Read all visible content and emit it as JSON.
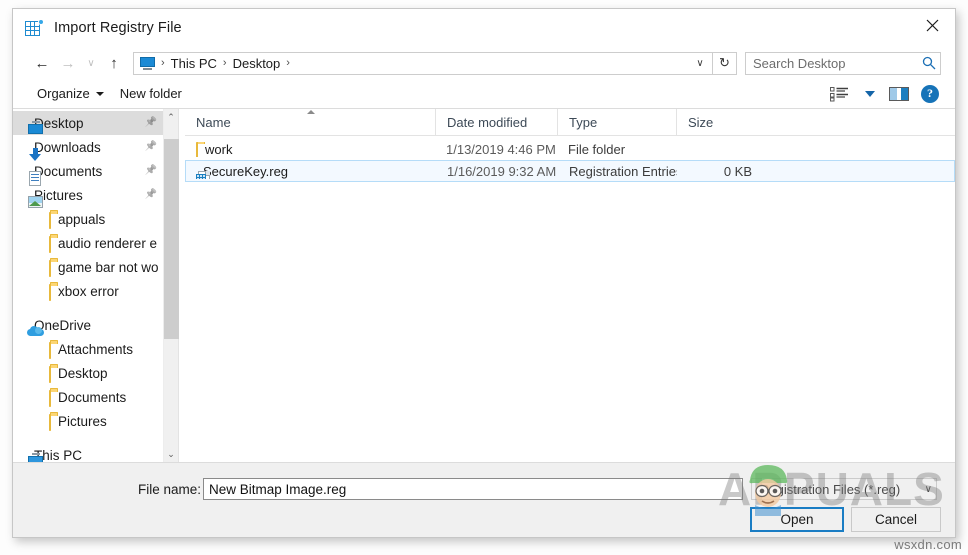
{
  "window": {
    "title": "Import Registry File",
    "icon": "registry-file-icon",
    "close_label": "✕"
  },
  "navigation": {
    "back_label": "←",
    "forward_label": "→",
    "recent_label": "∨",
    "up_label": "↑",
    "refresh_label": "↻",
    "dropdown_label": "∨",
    "breadcrumb": [
      {
        "label": "This PC"
      },
      {
        "label": "Desktop"
      }
    ],
    "breadcrumb_separator": "›"
  },
  "search": {
    "placeholder": "Search Desktop",
    "value": "Search Desktop",
    "icon": "search-icon"
  },
  "command_bar": {
    "organize_label": "Organize",
    "new_folder_label": "New folder",
    "view_icon": "view-options-icon",
    "view_caret": "▾",
    "preview_pane_icon": "preview-pane-icon",
    "help_label": "?"
  },
  "nav_pane": {
    "items": [
      {
        "label": "Desktop",
        "icon": "monitor-icon",
        "indent": 0,
        "pinned": true,
        "selected": true
      },
      {
        "label": "Downloads",
        "icon": "download-icon",
        "indent": 0,
        "pinned": true,
        "selected": false
      },
      {
        "label": "Documents",
        "icon": "document-icon",
        "indent": 0,
        "pinned": true,
        "selected": false
      },
      {
        "label": "Pictures",
        "icon": "picture-icon",
        "indent": 0,
        "pinned": true,
        "selected": false
      },
      {
        "label": "appuals",
        "icon": "folder-icon",
        "indent": 1,
        "pinned": false,
        "selected": false
      },
      {
        "label": "audio renderer e",
        "icon": "folder-icon",
        "indent": 1,
        "pinned": false,
        "selected": false
      },
      {
        "label": "game bar not wo",
        "icon": "folder-icon",
        "indent": 1,
        "pinned": false,
        "selected": false
      },
      {
        "label": "xbox error",
        "icon": "folder-icon",
        "indent": 1,
        "pinned": false,
        "selected": false
      },
      {
        "label": "",
        "icon": "spacer",
        "indent": 0,
        "pinned": false,
        "selected": false
      },
      {
        "label": "OneDrive",
        "icon": "cloud-icon",
        "indent": 0,
        "pinned": false,
        "selected": false
      },
      {
        "label": "Attachments",
        "icon": "folder-icon",
        "indent": 1,
        "pinned": false,
        "selected": false
      },
      {
        "label": "Desktop",
        "icon": "folder-icon",
        "indent": 1,
        "pinned": false,
        "selected": false
      },
      {
        "label": "Documents",
        "icon": "folder-icon",
        "indent": 1,
        "pinned": false,
        "selected": false
      },
      {
        "label": "Pictures",
        "icon": "folder-icon",
        "indent": 1,
        "pinned": false,
        "selected": false
      },
      {
        "label": "",
        "icon": "spacer",
        "indent": 0,
        "pinned": false,
        "selected": false
      },
      {
        "label": "This PC",
        "icon": "pc-icon",
        "indent": 0,
        "pinned": false,
        "selected": false
      }
    ],
    "scroll_up": "⌃",
    "scroll_down": "⌄"
  },
  "file_list": {
    "columns": [
      {
        "key": "name",
        "label": "Name",
        "sorted": true
      },
      {
        "key": "date",
        "label": "Date modified",
        "sorted": false
      },
      {
        "key": "type",
        "label": "Type",
        "sorted": false
      },
      {
        "key": "size",
        "label": "Size",
        "sorted": false
      }
    ],
    "rows": [
      {
        "name": "work",
        "date": "1/13/2019 4:46 PM",
        "type": "File folder",
        "size": "",
        "icon": "folder-icon",
        "selected": false
      },
      {
        "name": "SecureKey.reg",
        "date": "1/16/2019 9:32 AM",
        "type": "Registration Entries",
        "size": "0 KB",
        "icon": "reg-file-icon",
        "selected": true
      }
    ]
  },
  "footer": {
    "file_name_label": "File name:",
    "file_name_value": "New Bitmap Image.reg",
    "file_type_value": "Registration Files (*.reg)",
    "file_type_caret": "∨",
    "open_label": "Open",
    "cancel_label": "Cancel"
  },
  "watermarks": {
    "brand": "APPUALS",
    "site": "wsxdn.com"
  },
  "colors": {
    "accent": "#1a7dc4",
    "selection": "#f3f9ff",
    "selection_border": "#b5dcf8",
    "nav_selected": "#dcdcdc",
    "folder": "#fcd675",
    "chrome": "#f0f0f0"
  }
}
